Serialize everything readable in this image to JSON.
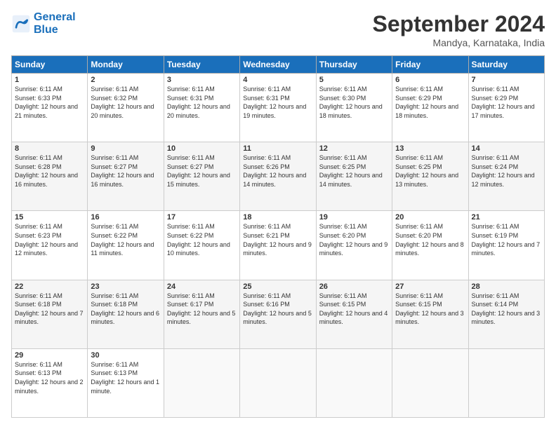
{
  "logo": {
    "line1": "General",
    "line2": "Blue"
  },
  "title": "September 2024",
  "subtitle": "Mandya, Karnataka, India",
  "days_header": [
    "Sunday",
    "Monday",
    "Tuesday",
    "Wednesday",
    "Thursday",
    "Friday",
    "Saturday"
  ],
  "weeks": [
    [
      {
        "day": "1",
        "sunrise": "6:11 AM",
        "sunset": "6:33 PM",
        "daylight": "12 hours and 21 minutes."
      },
      {
        "day": "2",
        "sunrise": "6:11 AM",
        "sunset": "6:32 PM",
        "daylight": "12 hours and 20 minutes."
      },
      {
        "day": "3",
        "sunrise": "6:11 AM",
        "sunset": "6:31 PM",
        "daylight": "12 hours and 20 minutes."
      },
      {
        "day": "4",
        "sunrise": "6:11 AM",
        "sunset": "6:31 PM",
        "daylight": "12 hours and 19 minutes."
      },
      {
        "day": "5",
        "sunrise": "6:11 AM",
        "sunset": "6:30 PM",
        "daylight": "12 hours and 18 minutes."
      },
      {
        "day": "6",
        "sunrise": "6:11 AM",
        "sunset": "6:29 PM",
        "daylight": "12 hours and 18 minutes."
      },
      {
        "day": "7",
        "sunrise": "6:11 AM",
        "sunset": "6:29 PM",
        "daylight": "12 hours and 17 minutes."
      }
    ],
    [
      {
        "day": "8",
        "sunrise": "6:11 AM",
        "sunset": "6:28 PM",
        "daylight": "12 hours and 16 minutes."
      },
      {
        "day": "9",
        "sunrise": "6:11 AM",
        "sunset": "6:27 PM",
        "daylight": "12 hours and 16 minutes."
      },
      {
        "day": "10",
        "sunrise": "6:11 AM",
        "sunset": "6:27 PM",
        "daylight": "12 hours and 15 minutes."
      },
      {
        "day": "11",
        "sunrise": "6:11 AM",
        "sunset": "6:26 PM",
        "daylight": "12 hours and 14 minutes."
      },
      {
        "day": "12",
        "sunrise": "6:11 AM",
        "sunset": "6:25 PM",
        "daylight": "12 hours and 14 minutes."
      },
      {
        "day": "13",
        "sunrise": "6:11 AM",
        "sunset": "6:25 PM",
        "daylight": "12 hours and 13 minutes."
      },
      {
        "day": "14",
        "sunrise": "6:11 AM",
        "sunset": "6:24 PM",
        "daylight": "12 hours and 12 minutes."
      }
    ],
    [
      {
        "day": "15",
        "sunrise": "6:11 AM",
        "sunset": "6:23 PM",
        "daylight": "12 hours and 12 minutes."
      },
      {
        "day": "16",
        "sunrise": "6:11 AM",
        "sunset": "6:22 PM",
        "daylight": "12 hours and 11 minutes."
      },
      {
        "day": "17",
        "sunrise": "6:11 AM",
        "sunset": "6:22 PM",
        "daylight": "12 hours and 10 minutes."
      },
      {
        "day": "18",
        "sunrise": "6:11 AM",
        "sunset": "6:21 PM",
        "daylight": "12 hours and 9 minutes."
      },
      {
        "day": "19",
        "sunrise": "6:11 AM",
        "sunset": "6:20 PM",
        "daylight": "12 hours and 9 minutes."
      },
      {
        "day": "20",
        "sunrise": "6:11 AM",
        "sunset": "6:20 PM",
        "daylight": "12 hours and 8 minutes."
      },
      {
        "day": "21",
        "sunrise": "6:11 AM",
        "sunset": "6:19 PM",
        "daylight": "12 hours and 7 minutes."
      }
    ],
    [
      {
        "day": "22",
        "sunrise": "6:11 AM",
        "sunset": "6:18 PM",
        "daylight": "12 hours and 7 minutes."
      },
      {
        "day": "23",
        "sunrise": "6:11 AM",
        "sunset": "6:18 PM",
        "daylight": "12 hours and 6 minutes."
      },
      {
        "day": "24",
        "sunrise": "6:11 AM",
        "sunset": "6:17 PM",
        "daylight": "12 hours and 5 minutes."
      },
      {
        "day": "25",
        "sunrise": "6:11 AM",
        "sunset": "6:16 PM",
        "daylight": "12 hours and 5 minutes."
      },
      {
        "day": "26",
        "sunrise": "6:11 AM",
        "sunset": "6:15 PM",
        "daylight": "12 hours and 4 minutes."
      },
      {
        "day": "27",
        "sunrise": "6:11 AM",
        "sunset": "6:15 PM",
        "daylight": "12 hours and 3 minutes."
      },
      {
        "day": "28",
        "sunrise": "6:11 AM",
        "sunset": "6:14 PM",
        "daylight": "12 hours and 3 minutes."
      }
    ],
    [
      {
        "day": "29",
        "sunrise": "6:11 AM",
        "sunset": "6:13 PM",
        "daylight": "12 hours and 2 minutes."
      },
      {
        "day": "30",
        "sunrise": "6:11 AM",
        "sunset": "6:13 PM",
        "daylight": "12 hours and 1 minute."
      },
      null,
      null,
      null,
      null,
      null
    ]
  ]
}
